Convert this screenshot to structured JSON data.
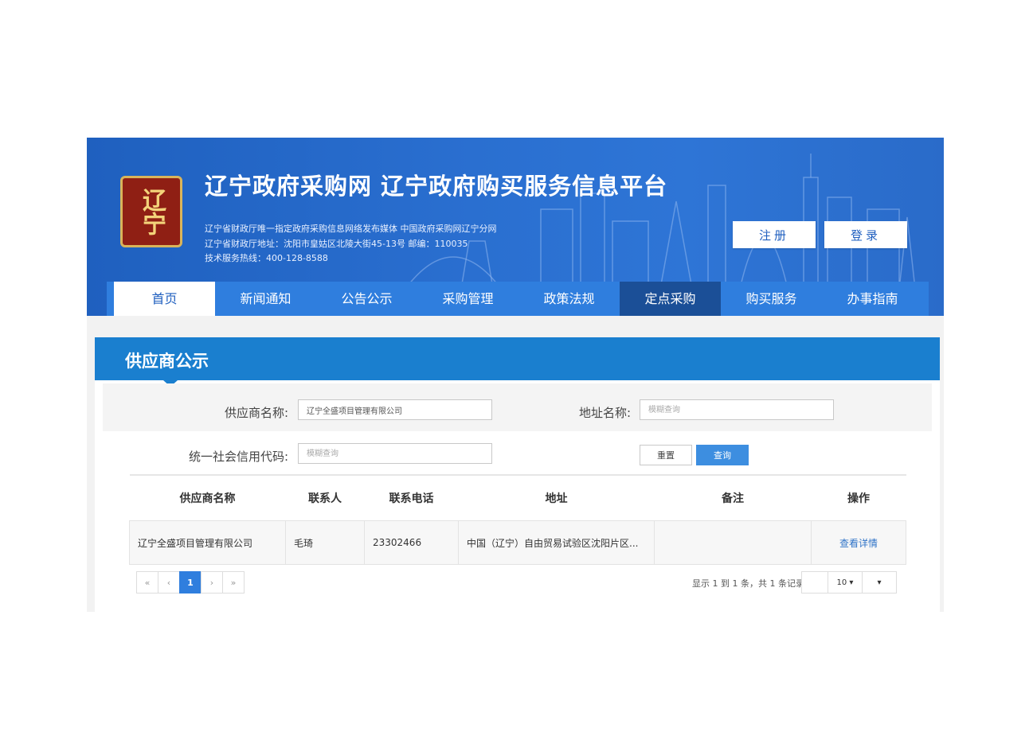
{
  "header": {
    "logo_text": "辽宁",
    "site_title": "辽宁政府采购网 辽宁政府购买服务信息平台",
    "info_lines": [
      "辽宁省财政厅唯一指定政府采购信息网络发布媒体 中国政府采购网辽宁分网",
      "辽宁省财政厅地址：沈阳市皇姑区北陵大街45-13号 邮编：110035",
      "技术服务热线：400-128-8588"
    ],
    "register_label": "注册",
    "login_label": "登录"
  },
  "nav": {
    "items": [
      "首页",
      "新闻通知",
      "公告公示",
      "采购管理",
      "政策法规",
      "定点采购",
      "购买服务",
      "办事指南"
    ]
  },
  "panel": {
    "title": "供应商公示"
  },
  "search": {
    "supplier_name_label": "供应商名称:",
    "supplier_name_value": "辽宁全盛项目管理有限公司",
    "address_label": "地址名称:",
    "address_placeholder": "模糊查询",
    "credit_code_label": "统一社会信用代码:",
    "credit_code_placeholder": "模糊查询",
    "reset_label": "重置",
    "query_label": "查询"
  },
  "table": {
    "columns": [
      "供应商名称",
      "联系人",
      "联系电话",
      "地址",
      "备注",
      "操作"
    ],
    "rows": [
      {
        "name": "辽宁全盛项目管理有限公司",
        "contact": "毛琦",
        "phone": "23302466",
        "address": "中国（辽宁）自由贸易试验区沈阳片区...",
        "remark": "",
        "action": "查看详情"
      }
    ]
  },
  "pagination": {
    "first": "«",
    "prev": "‹",
    "current": "1",
    "next": "›",
    "last": "»",
    "summary": "显示 1 到 1 条，共 1 条记录",
    "page_size": "10 ▾",
    "page_size_caret": "▾"
  },
  "colors": {
    "banner_blue": "#2a6fd0",
    "nav_blue": "#2f7ede",
    "panel_blue": "#1a7fcf",
    "active_dark": "#1b4f97"
  }
}
